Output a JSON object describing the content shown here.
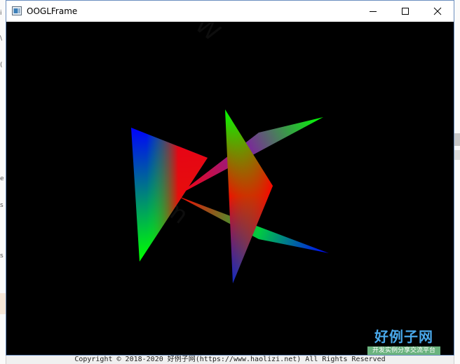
{
  "window": {
    "title": "OOGLFrame",
    "buttons": {
      "minimize": "minimize-icon",
      "maximize": "maximize-icon",
      "close": "close-icon"
    },
    "frame_color": "#6b8fbf"
  },
  "canvas": {
    "background": "#000000",
    "gradient_colors": [
      "#ff0000",
      "#00ff00",
      "#0000ff"
    ],
    "triangle_count": 4
  },
  "watermark": {
    "title": "好例子网",
    "subtitle": "开发实例分享交流平台",
    "title_color": "#49a8ea",
    "subtitle_bg": "#6ab37e"
  },
  "background_page": {
    "footer_text": "Copyright © 2018-2020 好例子网(https://www.haolizi.net) All Rights Reserved",
    "left_fragments": [
      "i",
      "\\",
      "(",
      "e",
      "s",
      "s"
    ]
  }
}
